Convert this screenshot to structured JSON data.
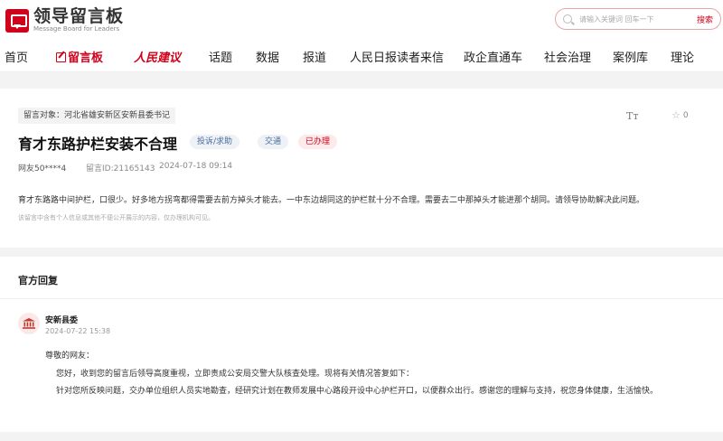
{
  "header": {
    "logo_cn": "领导留言板",
    "logo_en": "Message Board for Leaders",
    "search_placeholder": "请输入关键词 回车一下",
    "search_button": "搜索"
  },
  "nav": {
    "items": [
      "首页",
      "留言板",
      "人民建议",
      "话题",
      "数据",
      "报道",
      "人民日报读者来信",
      "政企直通车",
      "社会治理",
      "案例库",
      "理论"
    ]
  },
  "message": {
    "target": "留言对象：河北省雄安新区安新县委书记",
    "font_size_label": "Tт",
    "star_count": "0",
    "title": "育才东路护栏安装不合理",
    "tags": [
      "投诉/求助",
      "交通",
      "已办理"
    ],
    "user": "网友50****4",
    "id": "留言ID:21165143",
    "date": "2024-07-18 09:14",
    "content": "育才东路路中间护栏，口很少。好多地方拐弯都得需要去前方掉头才能去。一中东边胡同这的护栏就十分不合理。需要去二中那掉头才能进那个胡同。请领导协助解决此问题。",
    "notice": "该留言中含有个人信息或其他不便公开展示的内容，仅办理机构可见。"
  },
  "reply": {
    "section_title": "官方回复",
    "org": "安新县委",
    "date": "2024-07-22 15:38",
    "greeting": "尊敬的网友：",
    "para1": "您好，收到您的留言后领导高度重视，立即责成公安局交警大队核查处理。现将有关情况答复如下：",
    "para2": "针对您所反映问题，交办单位组织人员实地勘查，经研究计划在教师发展中心路段开设中心护栏开口，以便群众出行。感谢您的理解与支持，祝您身体健康，生活愉快。"
  },
  "colors": {
    "accent": "#d0021b",
    "tag_blue": "#4a6c9b"
  }
}
